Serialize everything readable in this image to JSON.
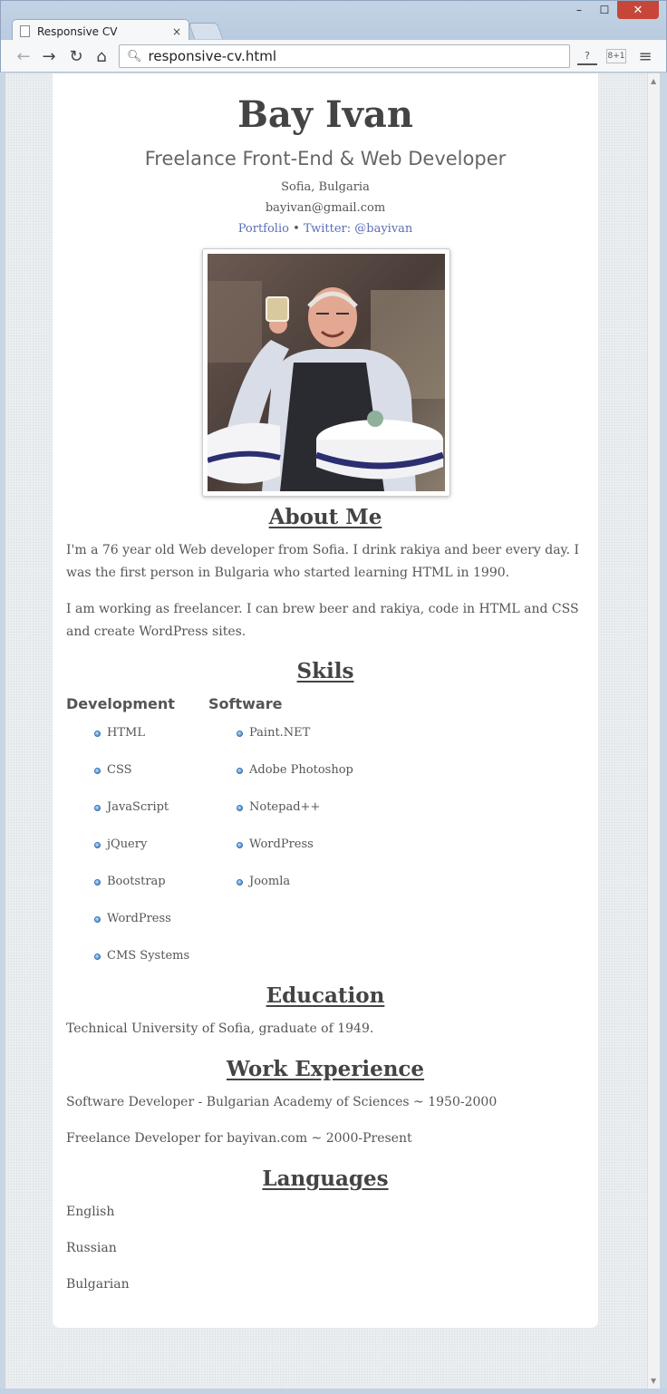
{
  "browser": {
    "tab_title": "Responsive CV",
    "tab_close": "×",
    "url": "responsive-cv.html",
    "window_controls": {
      "minimize": "–",
      "maximize": "☐",
      "close": "✕"
    },
    "icons": [
      "page-icon",
      "back-icon",
      "forward-icon",
      "reload-icon",
      "home-icon",
      "search-icon",
      "extension-icon",
      "google-plus-icon",
      "menu-icon"
    ]
  },
  "cv": {
    "name": "Bay Ivan",
    "role": "Freelance Front-End & Web Developer",
    "location": "Sofia, Bulgaria",
    "email": "bayivan@gmail.com",
    "links": {
      "portfolio": "Portfolio",
      "separator": "•",
      "twitter": "Twitter: @bayivan"
    },
    "about": {
      "title": "About Me",
      "paragraphs": [
        "I'm a 76 year old Web developer from Sofia. I drink rakiya and beer every day. I was the first person in Bulgaria who started learning HTML in 1990.",
        "I am working as freelancer. I can brew beer and rakiya, code in HTML and CSS and create WordPress sites."
      ]
    },
    "skills": {
      "title": "Skils",
      "development": {
        "title": "Development",
        "items": [
          "HTML",
          "CSS",
          "JavaScript",
          "jQuery",
          "Bootstrap",
          "WordPress",
          "CMS Systems"
        ]
      },
      "software": {
        "title": "Software",
        "items": [
          "Paint.NET",
          "Adobe Photoshop",
          "Notepad++",
          "WordPress",
          "Joomla"
        ]
      }
    },
    "education": {
      "title": "Education",
      "text": "Technical University of Sofia, graduate of 1949."
    },
    "work": {
      "title": "Work Experience",
      "items": [
        "Software Developer - Bulgarian Academy of Sciences ~ 1950-2000",
        "Freelance Developer for bayivan.com ~ 2000-Present"
      ]
    },
    "languages": {
      "title": "Languages",
      "items": [
        "English",
        "Russian",
        "Bulgarian"
      ]
    }
  },
  "colors": {
    "link": "#5b6fb7",
    "text": "#555555",
    "heading": "#444444",
    "close_button": "#c7463a"
  }
}
